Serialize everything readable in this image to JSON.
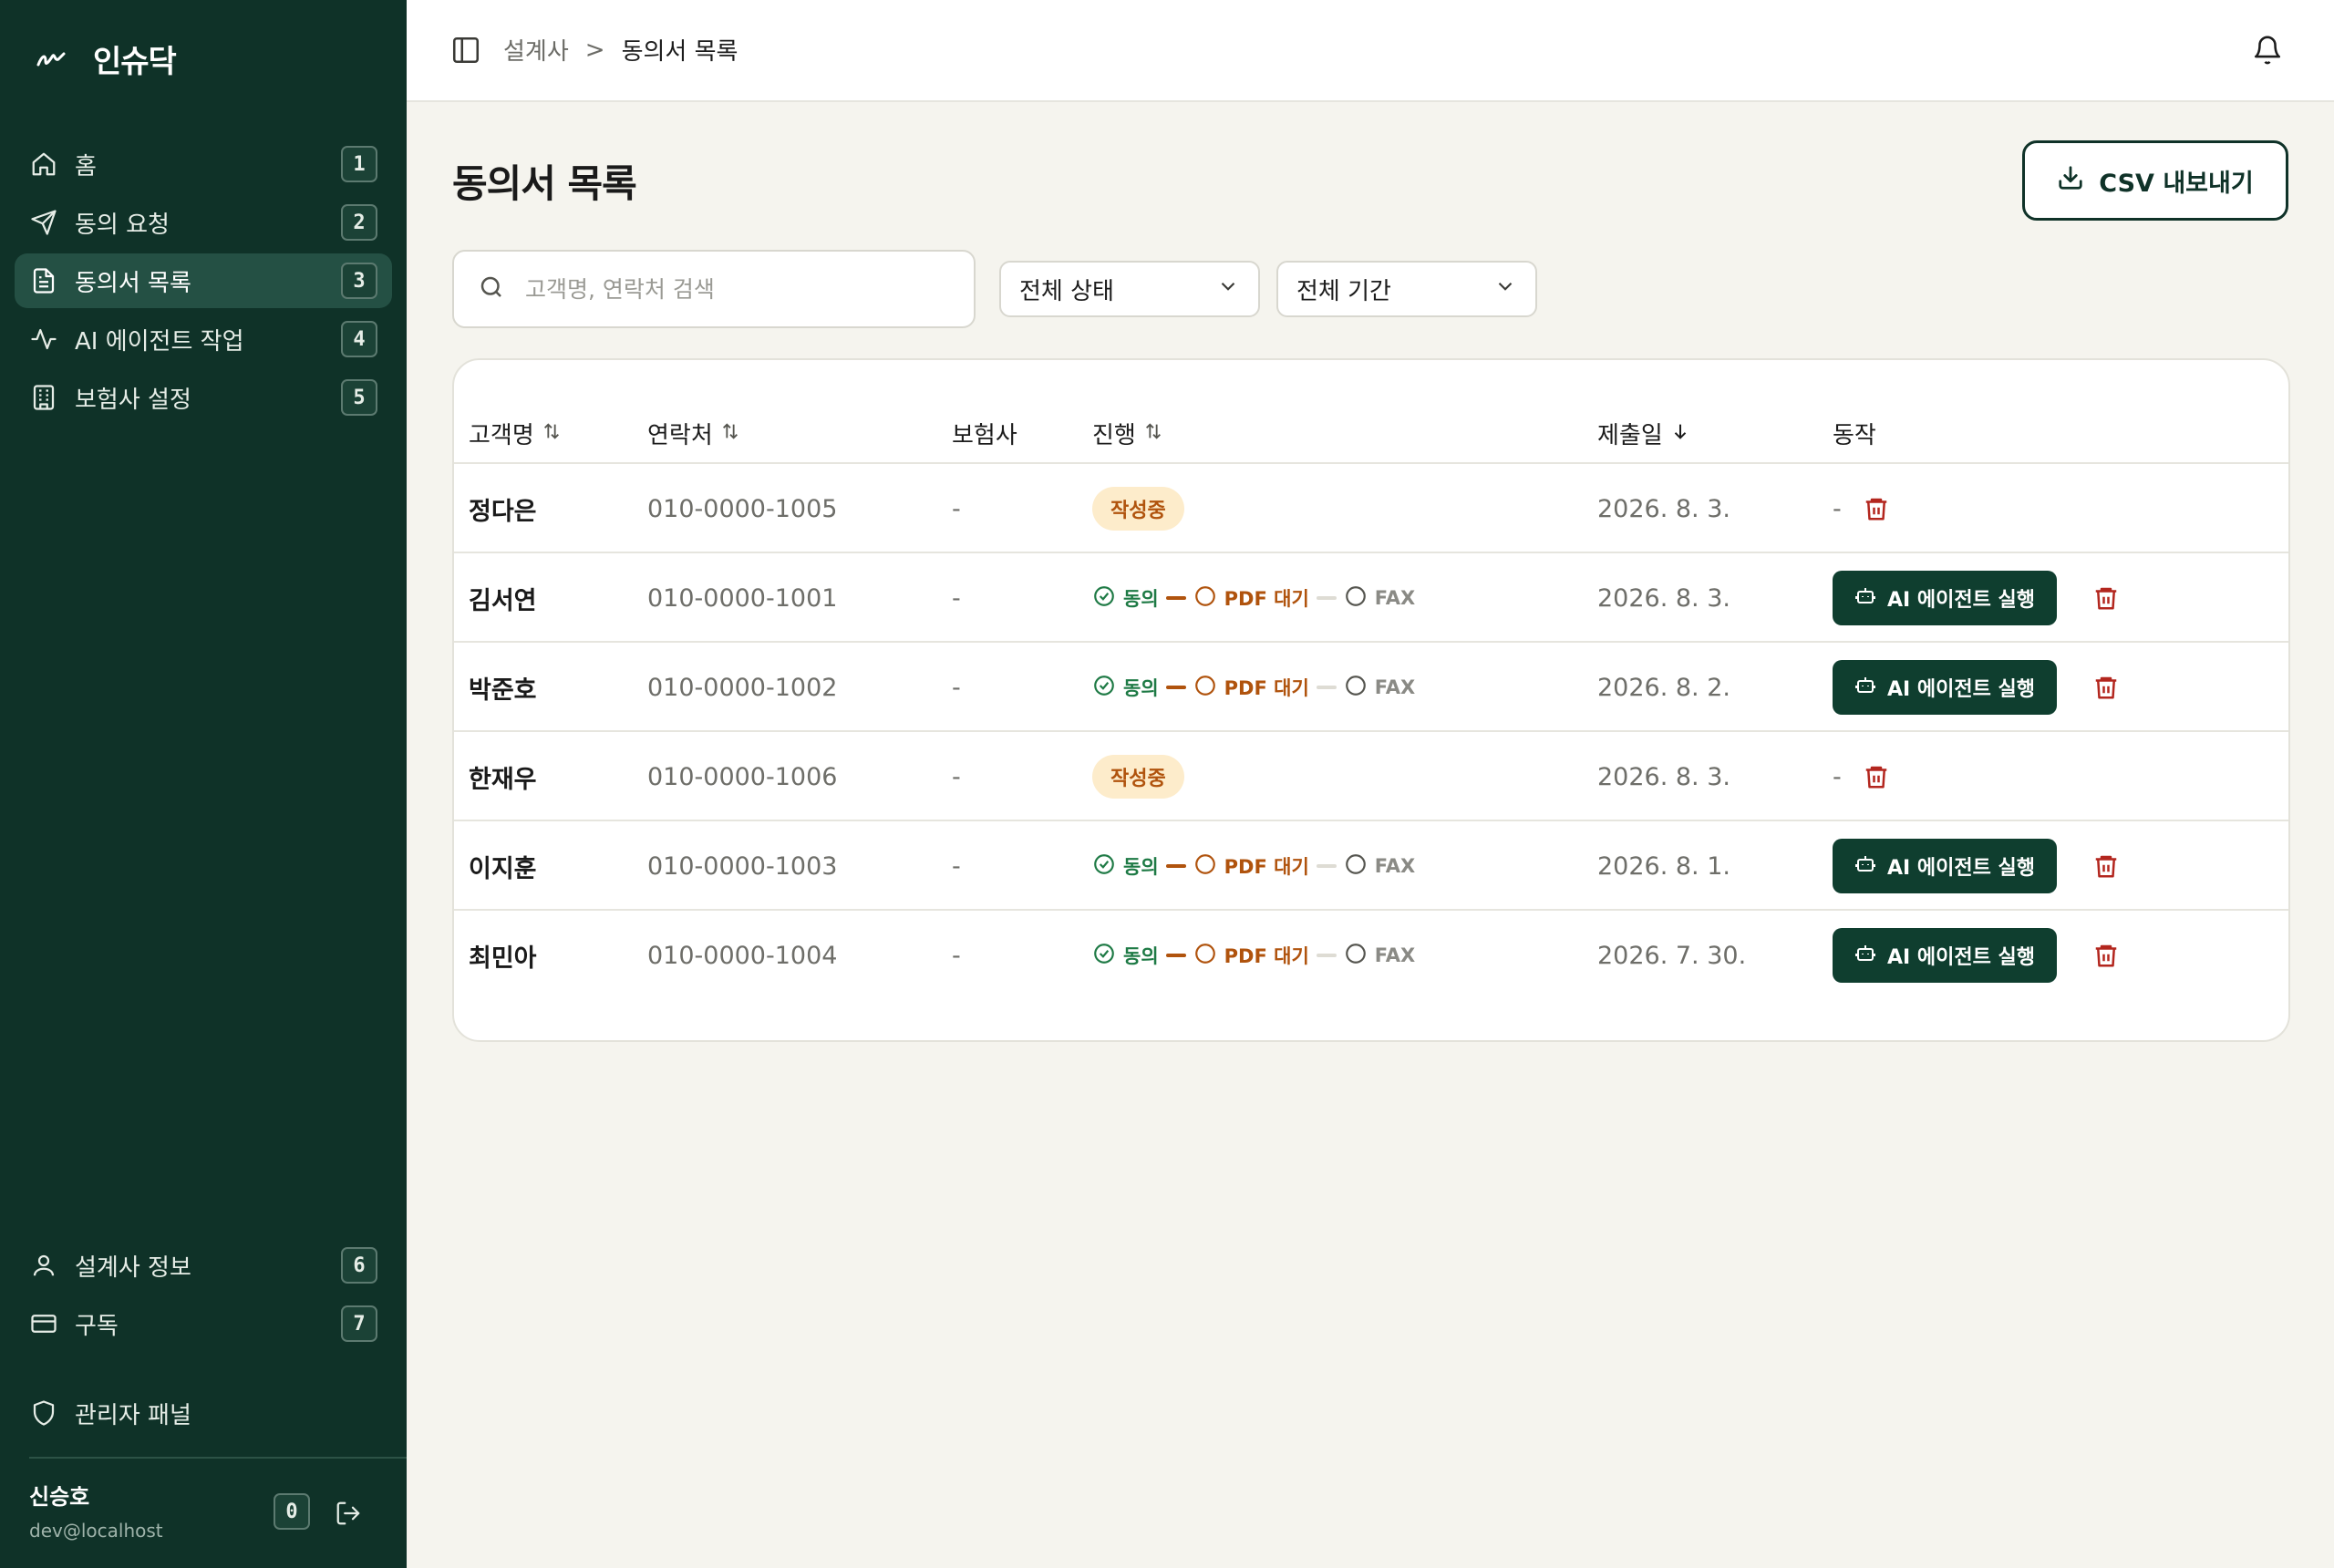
{
  "app": {
    "brand": "인슈닥"
  },
  "sidebar": {
    "items": [
      {
        "label": "홈",
        "shortcut": "1",
        "icon": "home-icon"
      },
      {
        "label": "동의 요청",
        "shortcut": "2",
        "icon": "send-icon"
      },
      {
        "label": "동의서 목록",
        "shortcut": "3",
        "icon": "document-icon",
        "active": true
      },
      {
        "label": "AI 에이전트 작업",
        "shortcut": "4",
        "icon": "activity-icon"
      },
      {
        "label": "보험사 설정",
        "shortcut": "5",
        "icon": "building-icon"
      }
    ],
    "bottom_items": [
      {
        "label": "설계사 정보",
        "shortcut": "6",
        "icon": "user-icon"
      },
      {
        "label": "구독",
        "shortcut": "7",
        "icon": "credit-card-icon"
      }
    ],
    "admin": {
      "label": "관리자 패널",
      "icon": "shield-icon"
    },
    "user": {
      "name": "신승호",
      "email": "dev@localhost",
      "shortcut": "0"
    }
  },
  "topbar": {
    "breadcrumb": {
      "parent": "설계사",
      "separator": ">",
      "current": "동의서 목록"
    }
  },
  "main": {
    "title": "동의서 목록",
    "export_label": "CSV 내보내기",
    "search": {
      "placeholder": "고객명, 연락처 검색",
      "value": ""
    },
    "filters": {
      "status": "전체 상태",
      "period": "전체 기간"
    },
    "table": {
      "headers": {
        "name": "고객명",
        "phone": "연락처",
        "insurer": "보험사",
        "progress": "진행",
        "submitted": "제출일",
        "actions": "동작"
      },
      "progress_labels": {
        "agree": "동의",
        "pdf": "PDF 대기",
        "fax": "FAX"
      },
      "draft_label": "작성중",
      "ai_run_label": "AI 에이전트 실행",
      "rows": [
        {
          "name": "정다은",
          "phone": "010-0000-1005",
          "insurer": "-",
          "status": "draft",
          "date": "2026. 8. 3.",
          "action": "-"
        },
        {
          "name": "김서연",
          "phone": "010-0000-1001",
          "insurer": "-",
          "status": "progress",
          "date": "2026. 8. 3.",
          "action": "ai"
        },
        {
          "name": "박준호",
          "phone": "010-0000-1002",
          "insurer": "-",
          "status": "progress",
          "date": "2026. 8. 2.",
          "action": "ai"
        },
        {
          "name": "한재우",
          "phone": "010-0000-1006",
          "insurer": "-",
          "status": "draft",
          "date": "2026. 8. 3.",
          "action": "-"
        },
        {
          "name": "이지훈",
          "phone": "010-0000-1003",
          "insurer": "-",
          "status": "progress",
          "date": "2026. 8. 1.",
          "action": "ai"
        },
        {
          "name": "최민아",
          "phone": "010-0000-1004",
          "insurer": "-",
          "status": "progress",
          "date": "2026. 7. 30.",
          "action": "ai"
        }
      ]
    }
  },
  "colors": {
    "sidebar_bg": "#0f3228",
    "accent": "#0f3e2f",
    "agree_green": "#1e7a45",
    "pending_orange": "#b0530d",
    "danger_red": "#b3261e",
    "page_bg": "#f5f4ee"
  }
}
